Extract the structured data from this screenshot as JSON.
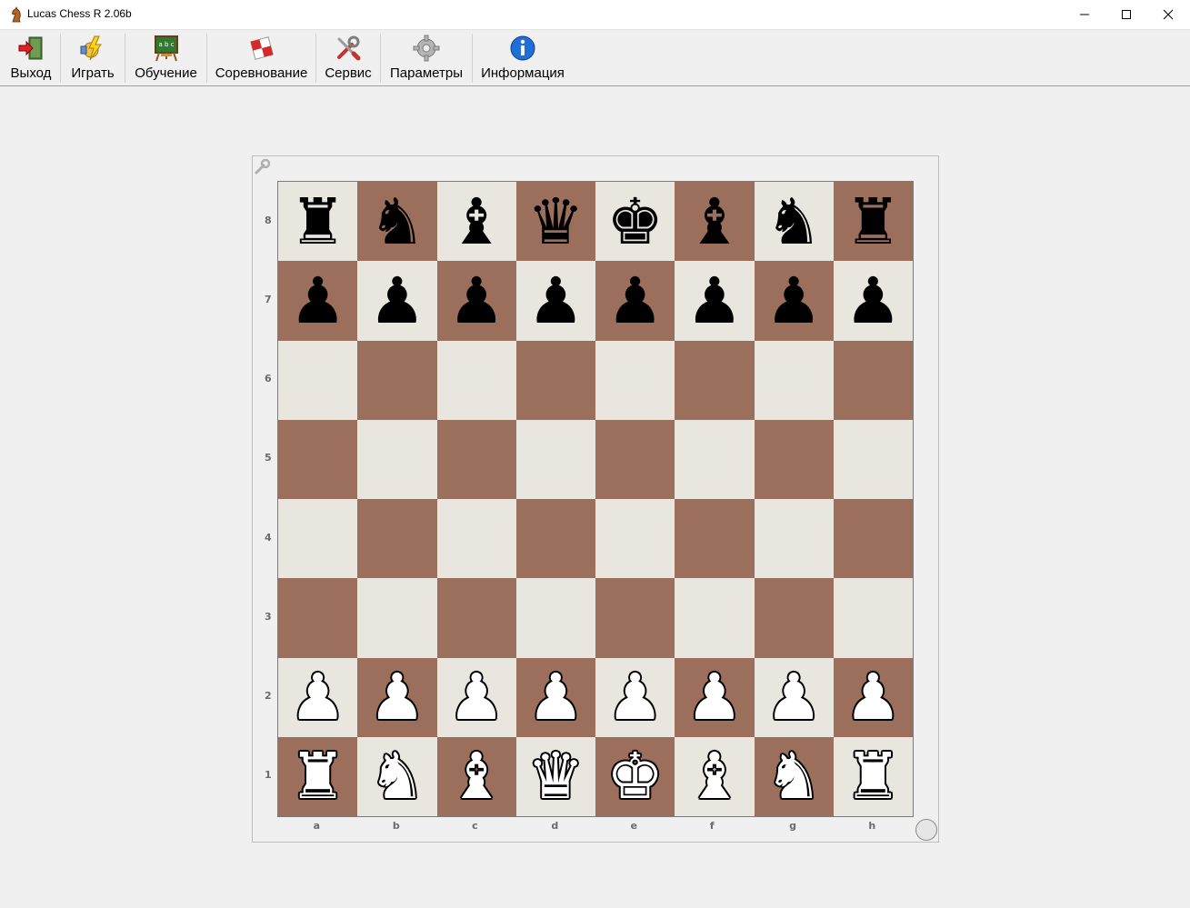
{
  "window": {
    "title": "Lucas Chess R 2.06b"
  },
  "toolbar": {
    "items": [
      {
        "label": "Выход",
        "icon": "exit-door-icon"
      },
      {
        "label": "Играть",
        "icon": "play-icon"
      },
      {
        "label": "Обучение",
        "icon": "training-board-icon"
      },
      {
        "label": "Соревнование",
        "icon": "competition-icon"
      },
      {
        "label": "Сервис",
        "icon": "tools-icon"
      },
      {
        "label": "Параметры",
        "icon": "gear-icon"
      },
      {
        "label": "Информация",
        "icon": "info-icon"
      }
    ]
  },
  "board": {
    "ranks": [
      "8",
      "7",
      "6",
      "5",
      "4",
      "3",
      "2",
      "1"
    ],
    "files": [
      "a",
      "b",
      "c",
      "d",
      "e",
      "f",
      "g",
      "h"
    ],
    "position": [
      [
        "r",
        "n",
        "b",
        "q",
        "k",
        "b",
        "n",
        "r"
      ],
      [
        "p",
        "p",
        "p",
        "p",
        "p",
        "p",
        "p",
        "p"
      ],
      [
        "",
        "",
        "",
        "",
        "",
        "",
        "",
        ""
      ],
      [
        "",
        "",
        "",
        "",
        "",
        "",
        "",
        ""
      ],
      [
        "",
        "",
        "",
        "",
        "",
        "",
        "",
        ""
      ],
      [
        "",
        "",
        "",
        "",
        "",
        "",
        "",
        ""
      ],
      [
        "P",
        "P",
        "P",
        "P",
        "P",
        "P",
        "P",
        "P"
      ],
      [
        "R",
        "N",
        "B",
        "Q",
        "K",
        "B",
        "N",
        "R"
      ]
    ],
    "colors": {
      "light": "#e8e6df",
      "dark": "#9c6e5c"
    }
  }
}
